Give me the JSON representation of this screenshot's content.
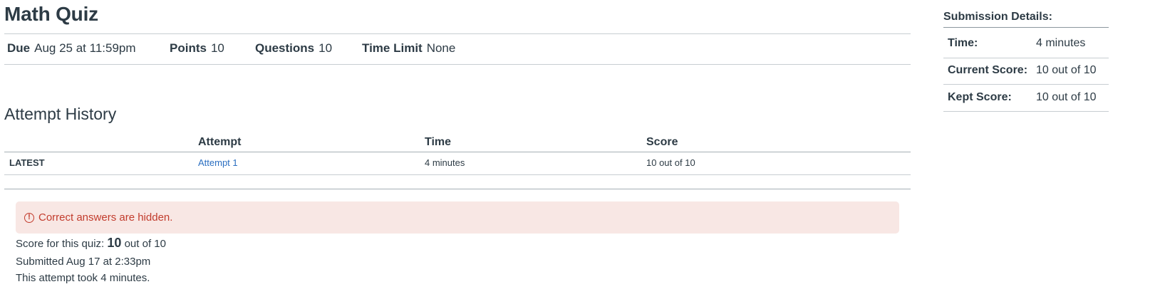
{
  "quiz": {
    "title": "Math Quiz",
    "meta": {
      "due_label": "Due",
      "due_value": "Aug 25 at 11:59pm",
      "points_label": "Points",
      "points_value": "10",
      "questions_label": "Questions",
      "questions_value": "10",
      "time_limit_label": "Time Limit",
      "time_limit_value": "None"
    }
  },
  "attempt_history": {
    "title": "Attempt History",
    "columns": [
      "Attempt",
      "Time",
      "Score"
    ],
    "rows": [
      {
        "tag": "LATEST",
        "attempt": "Attempt 1",
        "time": "4 minutes",
        "score": "10 out of 10"
      }
    ]
  },
  "alert": {
    "icon": "alert-circle-icon",
    "text": "Correct answers are hidden.",
    "color": "#c23c2d",
    "background": "#f8e7e4"
  },
  "result": {
    "score_prefix": "Score for this quiz:",
    "score_value": "10",
    "score_suffix": "out of 10",
    "submitted": "Submitted Aug 17 at 2:33pm",
    "duration": "This attempt took 4 minutes."
  },
  "submission_details": {
    "title": "Submission Details:",
    "rows": [
      {
        "label": "Time:",
        "value": "4 minutes"
      },
      {
        "label": "Current Score:",
        "value": "10 out of 10"
      },
      {
        "label": "Kept Score:",
        "value": "10 out of 10"
      }
    ]
  },
  "colors": {
    "text": "#2d3b45",
    "link": "#2b6fc1"
  }
}
